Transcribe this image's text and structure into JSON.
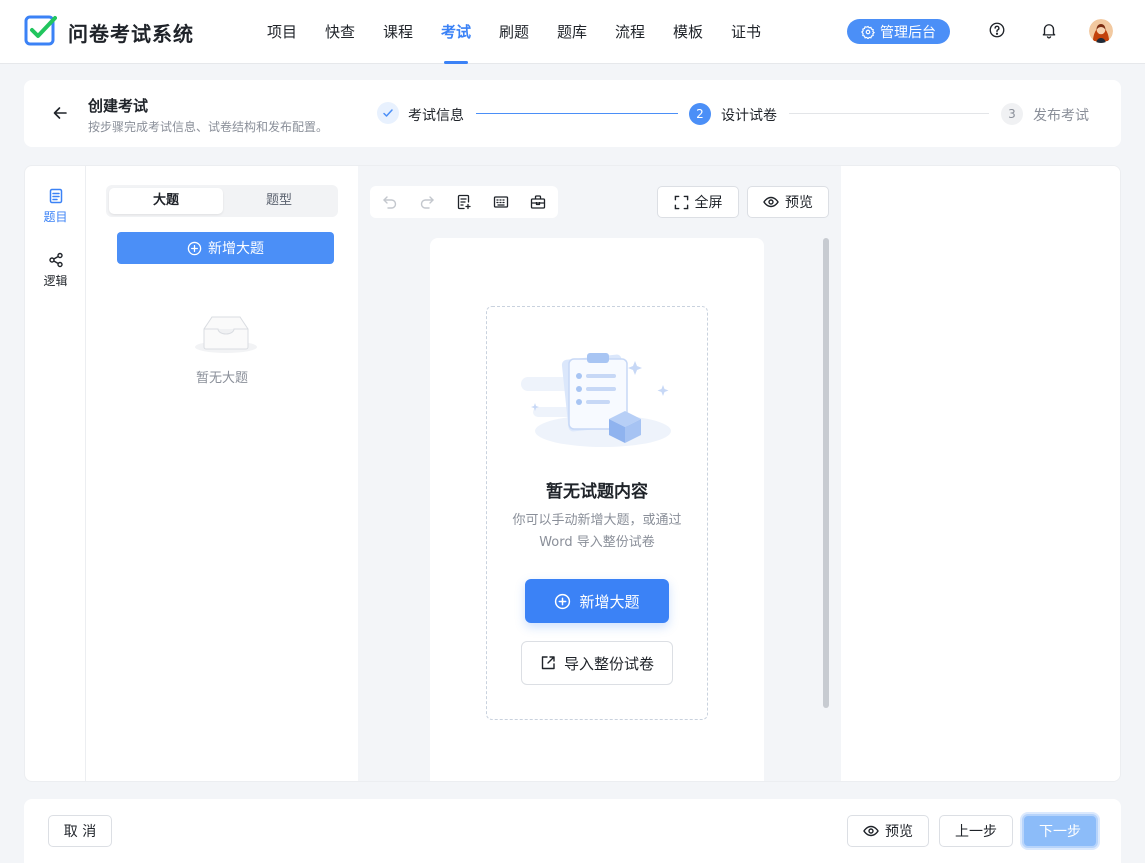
{
  "app": {
    "title": "问卷考试系统"
  },
  "nav": {
    "items": [
      {
        "label": "项目"
      },
      {
        "label": "快查"
      },
      {
        "label": "课程"
      },
      {
        "label": "考试"
      },
      {
        "label": "刷题"
      },
      {
        "label": "题库"
      },
      {
        "label": "流程"
      },
      {
        "label": "模板"
      },
      {
        "label": "证书"
      }
    ],
    "active_label": "考试",
    "admin_label": "管理后台"
  },
  "header": {
    "title": "创建考试",
    "subtitle": "按步骤完成考试信息、试卷结构和发布配置。",
    "steps": [
      {
        "label": "考试信息",
        "status": "done"
      },
      {
        "number": "2",
        "label": "设计试卷",
        "status": "active"
      },
      {
        "number": "3",
        "label": "发布考试",
        "status": "todo"
      }
    ]
  },
  "side_tabs": [
    {
      "label": "题目",
      "icon": "document-icon",
      "active": true
    },
    {
      "label": "逻辑",
      "icon": "share-nodes-icon",
      "active": false
    }
  ],
  "left_panel": {
    "segments": [
      "大题",
      "题型"
    ],
    "add_button": "新增大题",
    "empty_text": "暂无大题"
  },
  "canvas": {
    "fullscreen_label": "全屏",
    "preview_label": "预览",
    "empty_title": "暂无试题内容",
    "empty_desc": "你可以手动新增大题，或通过 Word 导入整份试卷",
    "add_button": "新增大题",
    "import_button": "导入整份试卷"
  },
  "footer": {
    "cancel_label": "取 消",
    "preview_label": "预览",
    "prev_label": "上一步",
    "next_label": "下一步"
  },
  "colors": {
    "accent": "#3b82f6",
    "accent_soft": "#4b8ff7",
    "next_disabled": "#8cbcf9",
    "page_bg": "#f3f5f8"
  }
}
